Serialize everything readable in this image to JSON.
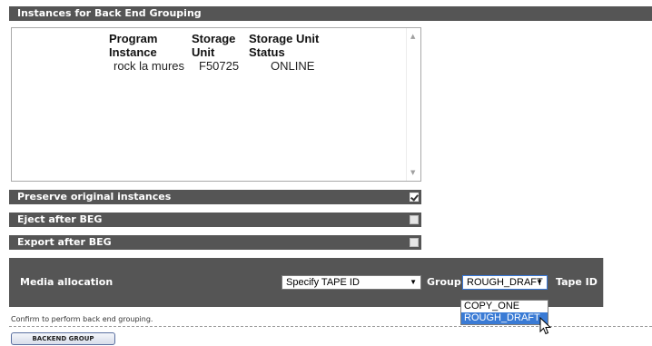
{
  "section_title": "Instances for Back End Grouping",
  "instances": {
    "headers": {
      "program_instance": [
        "Program",
        "Instance"
      ],
      "storage_unit": [
        "Storage",
        "Unit"
      ],
      "storage_unit_status": [
        "Storage Unit",
        "Status"
      ]
    },
    "rows": [
      {
        "program_instance": "rock la mures",
        "storage_unit": "F50725",
        "status": "ONLINE"
      }
    ]
  },
  "options": [
    {
      "label": "Preserve original instances",
      "checked": true
    },
    {
      "label": "Eject after BEG",
      "checked": false
    },
    {
      "label": "Export after BEG",
      "checked": false
    }
  ],
  "media": {
    "label": "Media allocation",
    "tape_select_value": "Specify TAPE ID",
    "group_label": "Group",
    "group_select_value": "ROUGH_DRAFT",
    "group_options": [
      "COPY_ONE",
      "ROUGH_DRAFT"
    ],
    "group_highlighted": "ROUGH_DRAFT",
    "tape_id_label": "Tape ID",
    "tape_id_value": ""
  },
  "confirm_text": "Confirm to perform back end grouping.",
  "backend_button": "BACKEND GROUP",
  "colors": {
    "header_bar": "#555555",
    "selection": "#3a7bd5"
  }
}
